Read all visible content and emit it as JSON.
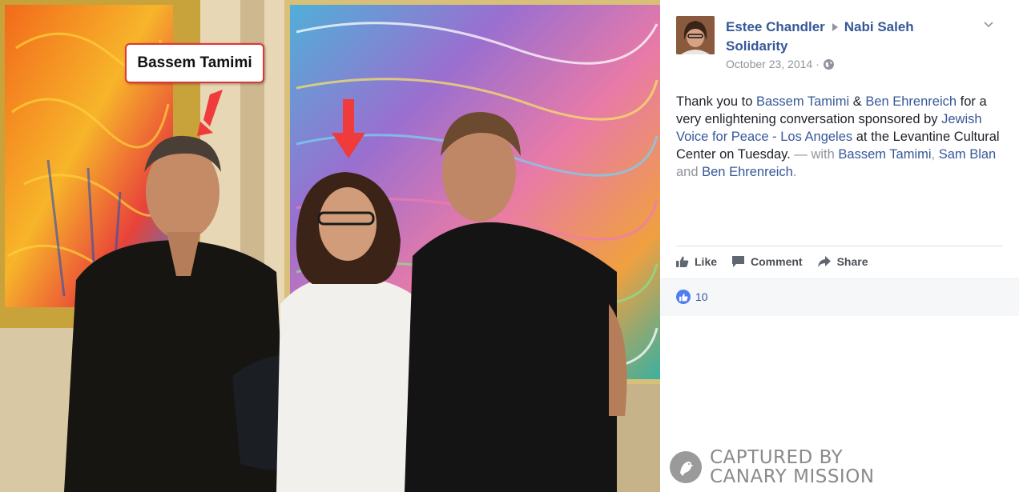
{
  "photo": {
    "callout_label": "Bassem Tamimi"
  },
  "watermark": {
    "line1": "CAPTURED BY",
    "line2": "CANARY MISSION"
  },
  "post": {
    "author": "Estee Chandler",
    "group": "Nabi Saleh Solidarity",
    "date": "October 23, 2014",
    "date_separator": "·",
    "privacy_icon": "globe-icon",
    "text": {
      "t1": "Thank you to ",
      "link1": "Bassem Tamimi",
      "t2": " & ",
      "link2": "Ben Ehrenreich",
      "t3": " for a very enlightening conversation sponsored by ",
      "link3": "Jewish Voice for Peace - Los Angeles",
      "t4": " at the Levantine Cultural Center on Tuesday.",
      "with_label": " — with ",
      "tag1": "Bassem Tamimi",
      "comma": ", ",
      "tag2": "Sam Blan",
      "and": " and ",
      "tag3": "Ben Ehrenreich",
      "period": "."
    }
  },
  "actions": {
    "like": "Like",
    "comment": "Comment",
    "share": "Share"
  },
  "reactions": {
    "count": "10"
  },
  "colors": {
    "link": "#365899",
    "muted": "#90949c",
    "like_blue": "#4f7ef0",
    "callout_red": "#e0363a"
  }
}
